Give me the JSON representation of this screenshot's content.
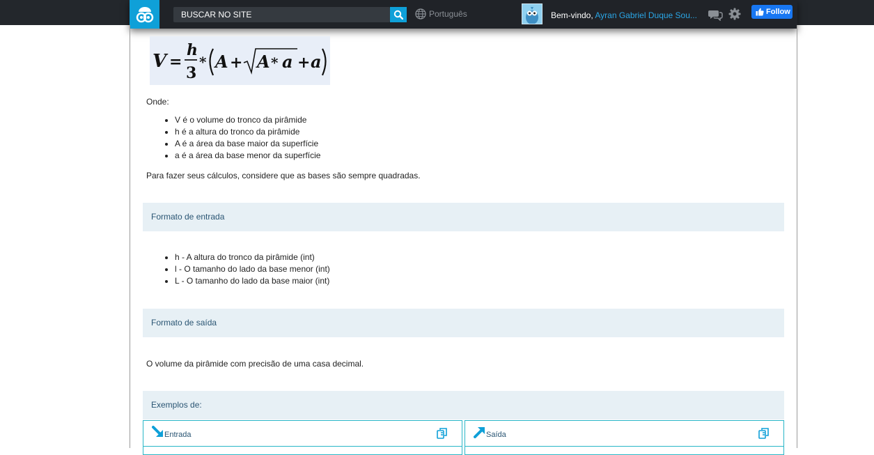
{
  "header": {
    "search_label": "BUSCAR NO SITE",
    "language": "Português",
    "welcome_prefix": "Bem-vindo,",
    "user_name": "Ayran Gabriel Duque Sou...",
    "follow_label": "Follow"
  },
  "problem": {
    "onde": "Onde:",
    "definitions": [
      "V é o volume do tronco da pirâmide",
      "h é a altura do tronco da pirâmide",
      "A é a área da base maior da superfície",
      "a é a área da base menor da superfície"
    ],
    "note": "Para fazer seus cálculos, considere que as bases são sempre quadradas."
  },
  "input_section": {
    "title": "Formato de entrada",
    "items": [
      "h - A altura do tronco da pirâmide (int)",
      "l - O tamanho do lado da base menor (int)",
      "L - O tamanho do lado da base maior (int)"
    ]
  },
  "output_section": {
    "title": "Formato de saída",
    "text": "O volume da pirâmide com precisão de uma casa decimal."
  },
  "examples": {
    "title": "Exemplos de:",
    "input_label": "Entrada",
    "output_label": "Saída"
  },
  "colors": {
    "accent": "#0fa0d8",
    "section_bg": "#e7f0f5",
    "example_border": "#28b6c7"
  }
}
